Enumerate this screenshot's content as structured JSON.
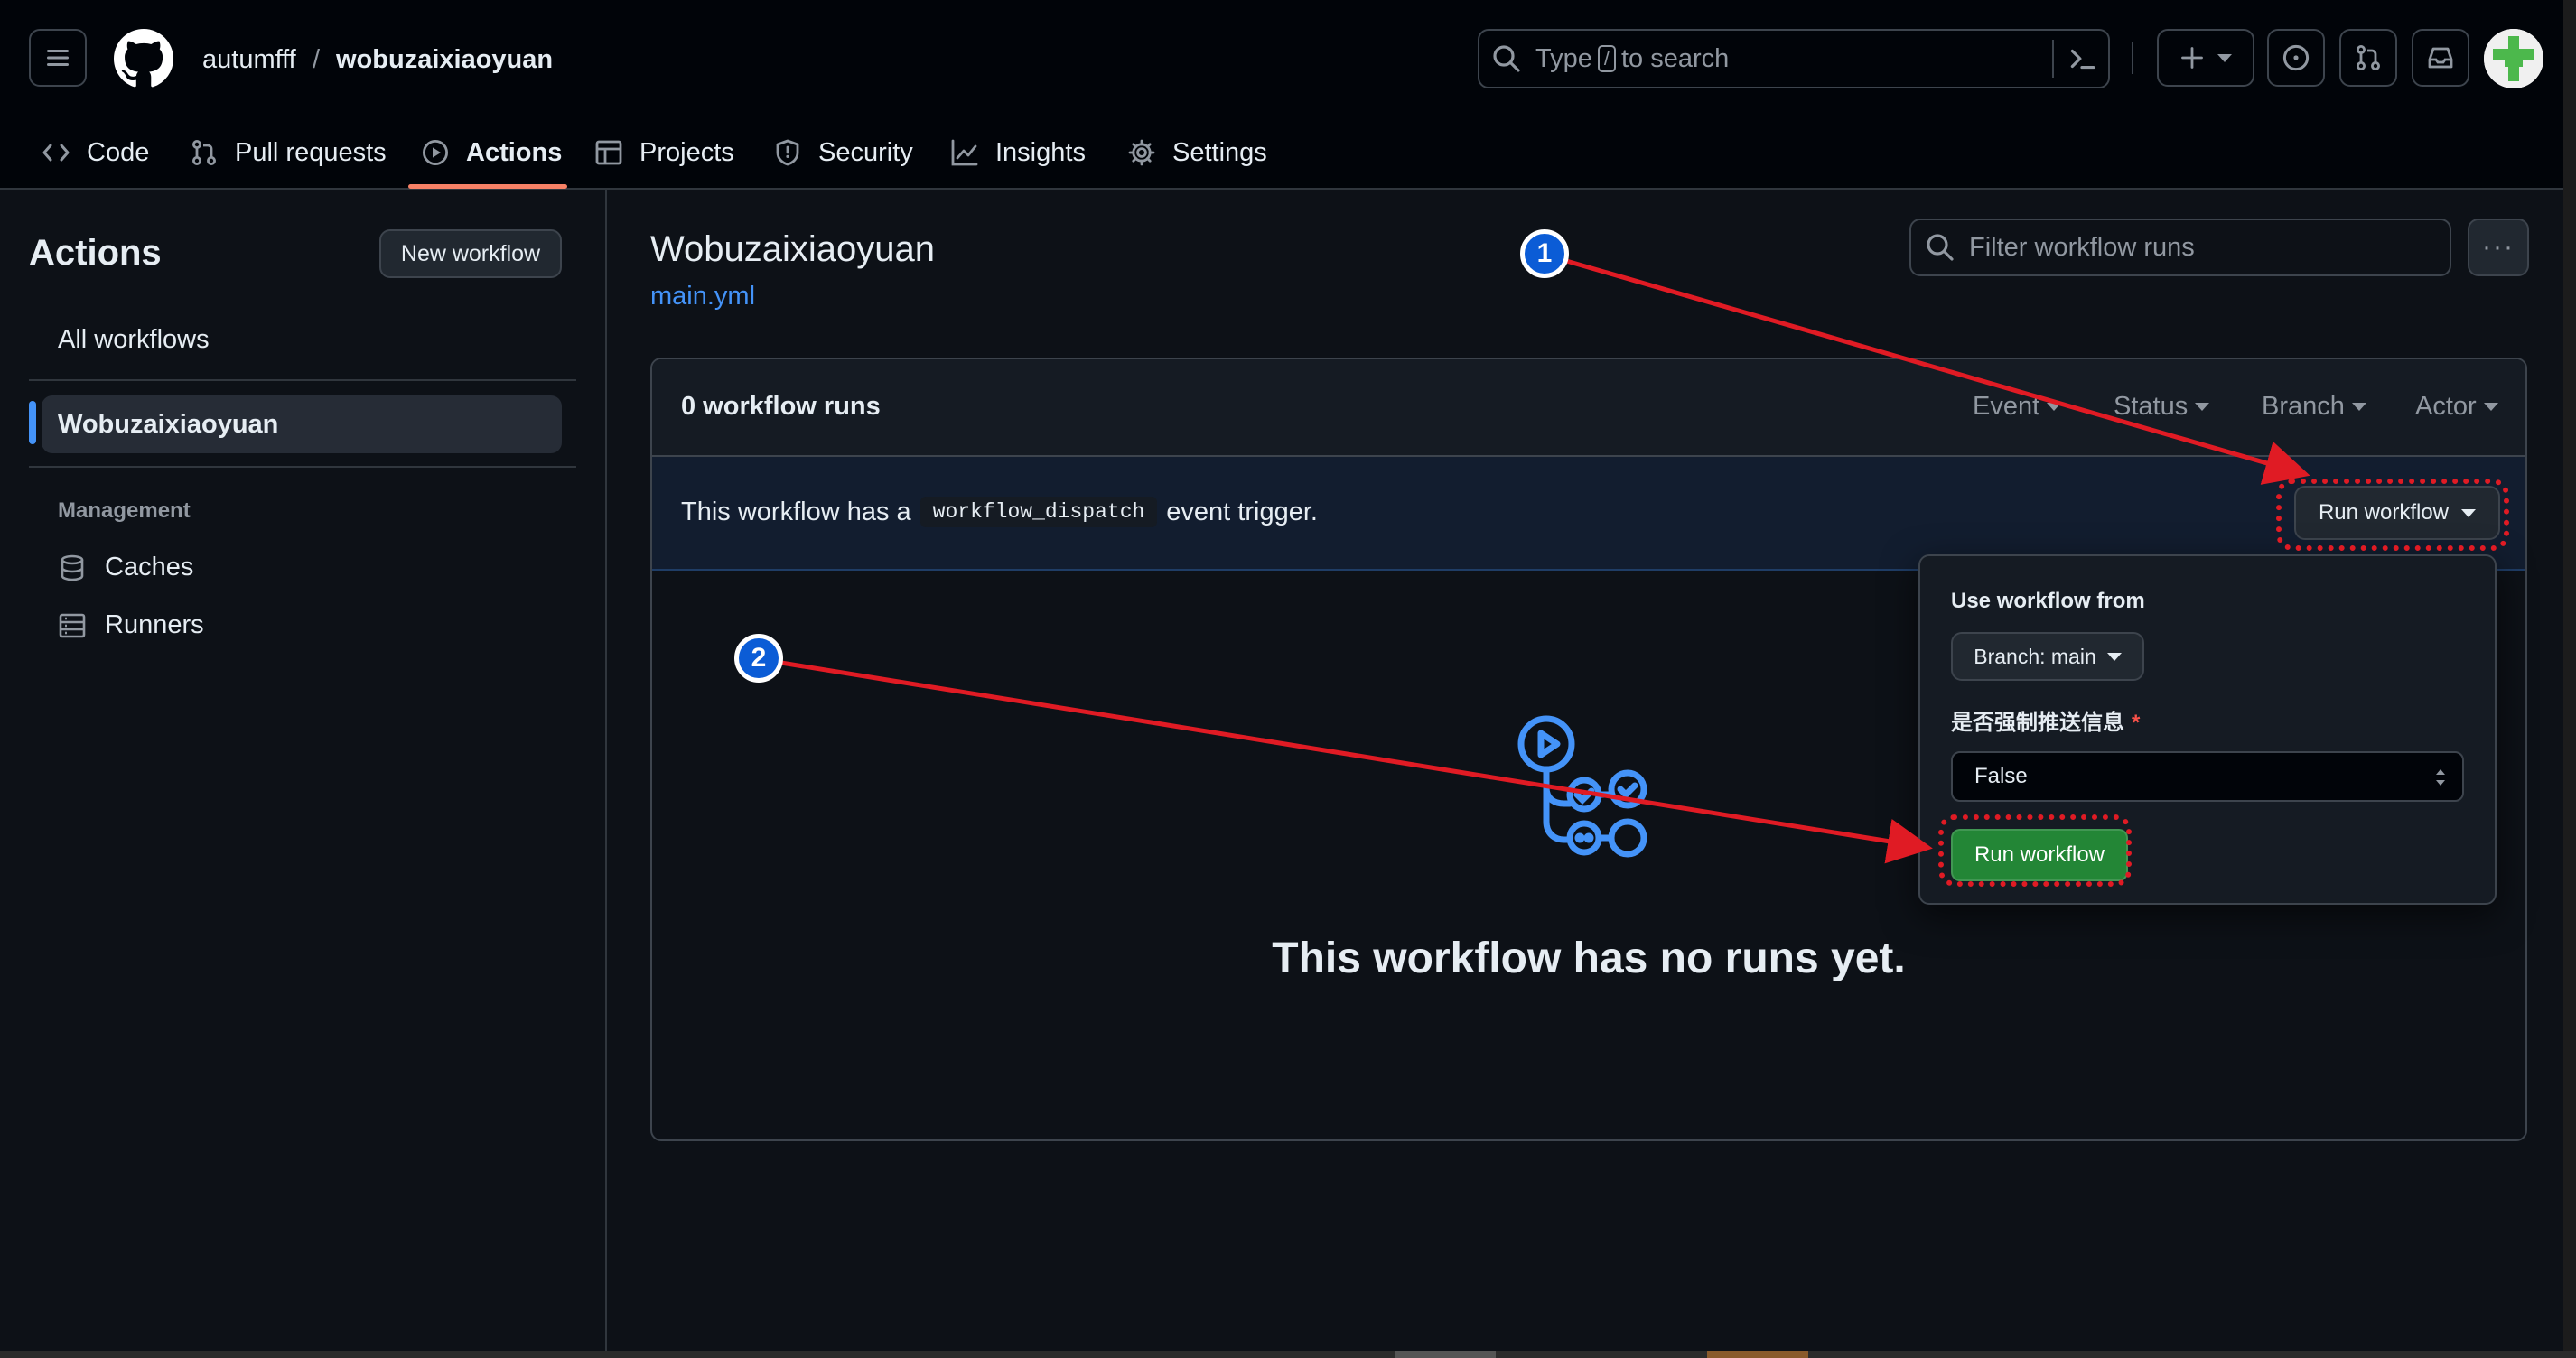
{
  "header": {
    "owner": "autumfff",
    "separator": "/",
    "repo": "wobuzaixiaoyuan",
    "search_prefix": "Type",
    "search_key": "/",
    "search_suffix": "to search"
  },
  "tabs": [
    {
      "label": "Code",
      "icon": "code-icon"
    },
    {
      "label": "Pull requests",
      "icon": "pull-request-icon"
    },
    {
      "label": "Actions",
      "icon": "play-icon",
      "active": true
    },
    {
      "label": "Projects",
      "icon": "table-icon"
    },
    {
      "label": "Security",
      "icon": "shield-icon"
    },
    {
      "label": "Insights",
      "icon": "graph-icon"
    },
    {
      "label": "Settings",
      "icon": "gear-icon"
    }
  ],
  "sidebar": {
    "title": "Actions",
    "new_workflow": "New workflow",
    "all_workflows": "All workflows",
    "workflow": "Wobuzaixiaoyuan",
    "management_title": "Management",
    "caches": "Caches",
    "runners": "Runners"
  },
  "main": {
    "workflow_title": "Wobuzaixiaoyuan",
    "workflow_file": "main.yml",
    "filter_placeholder": "Filter workflow runs",
    "more": "···",
    "runs_count": "0 workflow runs",
    "filters": [
      "Event",
      "Status",
      "Branch",
      "Actor"
    ],
    "dispatch_prefix": "This workflow has a",
    "dispatch_code": "workflow_dispatch",
    "dispatch_suffix": "event trigger.",
    "run_workflow": "Run workflow",
    "empty_title": "This workflow has no runs yet."
  },
  "popover": {
    "use_from": "Use workflow from",
    "branch": "Branch: main",
    "input_label": "是否强制推送信息",
    "required_mark": "*",
    "select_value": "False",
    "run_button": "Run workflow"
  },
  "annotations": {
    "step1": "1",
    "step2": "2"
  },
  "colors": {
    "accent_blue": "#4493f8",
    "green": "#238636",
    "annotation_red": "#e01b24",
    "tab_underline": "#f78166"
  }
}
